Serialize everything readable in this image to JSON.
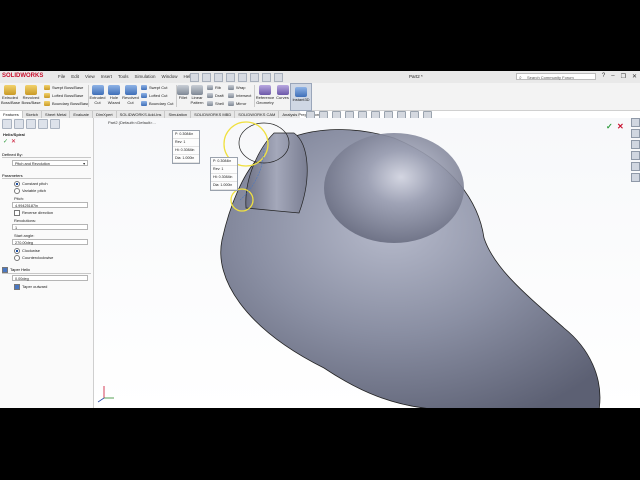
{
  "app": {
    "logo": "SOLIDWORKS",
    "menu": [
      "File",
      "Edit",
      "View",
      "Insert",
      "Tools",
      "Simulation",
      "Window",
      "Help"
    ],
    "doc_title": "Part2 *",
    "search_placeholder": "Search Community Forum",
    "window_buttons": [
      "?",
      "–",
      "❐",
      "✕"
    ]
  },
  "toolbar": {
    "extruded_boss": "Extruded Boss/Base",
    "revolved_boss": "Revolved Boss/Base",
    "swept_boss": "Swept Boss/Base",
    "lofted_boss": "Lofted Boss/Base",
    "boundary_boss": "Boundary Boss/Base",
    "extruded_cut": "Extruded Cut",
    "hole_wizard": "Hole Wizard",
    "revolved_cut": "Revolved Cut",
    "swept_cut": "Swept Cut",
    "lofted_cut": "Lofted Cut",
    "boundary_cut": "Boundary Cut",
    "fillet": "Fillet",
    "linear_pattern": "Linear Pattern",
    "rib": "Rib",
    "draft": "Draft",
    "shell": "Shell",
    "wrap": "Wrap",
    "intersect": "Intersect",
    "mirror": "Mirror",
    "reference_geometry": "Reference Geometry",
    "curves": "Curves",
    "instant3d": "Instant3D"
  },
  "tabs": [
    "Features",
    "Sketch",
    "Sheet Metal",
    "Evaluate",
    "DimXpert",
    "SOLIDWORKS Add-Ins",
    "Simulation",
    "SOLIDWORKS MBD",
    "SOLIDWORKS CAM",
    "Analysis Preparation"
  ],
  "breadcrumb": "Part2 (Default<<Default>...",
  "panel": {
    "title": "Helix/Spiral",
    "defined_by_header": "Defined By:",
    "defined_by_value": "Pitch and Revolution",
    "parameters_header": "Parameters",
    "constant_pitch": "Constant pitch",
    "variable_pitch": "Variable pitch",
    "pitch_label": "Pitch:",
    "pitch_value": "4.99425187in",
    "reverse_direction": "Reverse direction",
    "revolutions_label": "Revolutions:",
    "revolutions_value": "1",
    "start_angle_label": "Start angle:",
    "start_angle_value": "270.00deg",
    "clockwise": "Clockwise",
    "counterclockwise": "Counterclockwise",
    "taper_header": "Taper Helix",
    "taper_value": "0.00deg",
    "taper_outward": "Taper outward"
  },
  "callout1": {
    "rows": [
      "P:",
      "Rev:",
      "Ht:",
      "Dia:"
    ],
    "values": [
      "0.3084in",
      "1",
      "0.3084in",
      "1.000in"
    ]
  },
  "callout2": {
    "rows": [
      "P:",
      "Rev:",
      "Ht:",
      "Dia:"
    ],
    "values": [
      "0.3084in",
      "1",
      "0.3084in",
      "1.000in"
    ]
  },
  "colors": {
    "body": "#7d8294",
    "accent": "#c8102e",
    "selection": "#f0e040"
  }
}
